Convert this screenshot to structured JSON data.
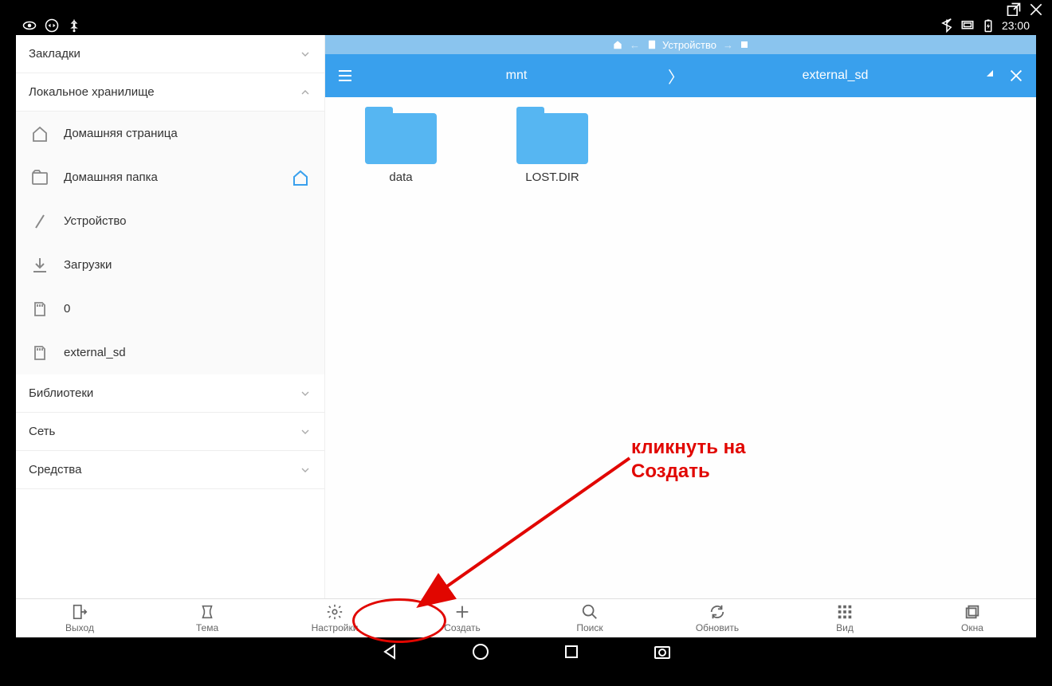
{
  "window_controls": {
    "share": "share-icon",
    "close": "close-icon"
  },
  "statusbar": {
    "time": "23:00",
    "left_icons": [
      "eye-icon",
      "teamviewer-icon",
      "usb-icon"
    ],
    "right_icons": [
      "bluetooth-icon",
      "display-icon",
      "battery-charging-icon"
    ]
  },
  "sidebar": {
    "sections": {
      "bookmarks": {
        "label": "Закладки",
        "expanded": false
      },
      "local": {
        "label": "Локальное хранилище",
        "expanded": true,
        "items": [
          {
            "icon": "home-outline-icon",
            "label": "Домашняя страница",
            "trail": null
          },
          {
            "icon": "folder-home-icon",
            "label": "Домашняя папка",
            "trail": "home"
          },
          {
            "icon": "slash-icon",
            "label": "Устройство",
            "trail": null
          },
          {
            "icon": "download-icon",
            "label": "Загрузки",
            "trail": null
          },
          {
            "icon": "sdcard-icon",
            "label": "0",
            "trail": null
          },
          {
            "icon": "sdcard-icon",
            "label": "external_sd",
            "trail": null
          }
        ]
      },
      "libraries": {
        "label": "Библиотеки",
        "expanded": false
      },
      "network": {
        "label": "Сеть",
        "expanded": false
      },
      "tools": {
        "label": "Средства",
        "expanded": false
      }
    }
  },
  "header": {
    "device_strip": {
      "label": "Устройство"
    },
    "path": {
      "segments": [
        "mnt",
        "external_sd"
      ]
    }
  },
  "files": [
    {
      "name": "data",
      "type": "folder"
    },
    {
      "name": "LOST.DIR",
      "type": "folder"
    }
  ],
  "toolbar": [
    {
      "icon": "exit-icon",
      "label": "Выход"
    },
    {
      "icon": "theme-icon",
      "label": "Тема"
    },
    {
      "icon": "settings-icon",
      "label": "Настройки"
    },
    {
      "icon": "plus-icon",
      "label": "Создать"
    },
    {
      "icon": "search-icon",
      "label": "Поиск"
    },
    {
      "icon": "refresh-icon",
      "label": "Обновить"
    },
    {
      "icon": "view-icon",
      "label": "Вид"
    },
    {
      "icon": "windows-icon",
      "label": "Окна"
    }
  ],
  "navbar": [
    "back-icon",
    "home-circle-icon",
    "recents-icon",
    "camera-icon"
  ],
  "annotation": {
    "line1": "кликнуть на",
    "line2": "Создать"
  }
}
